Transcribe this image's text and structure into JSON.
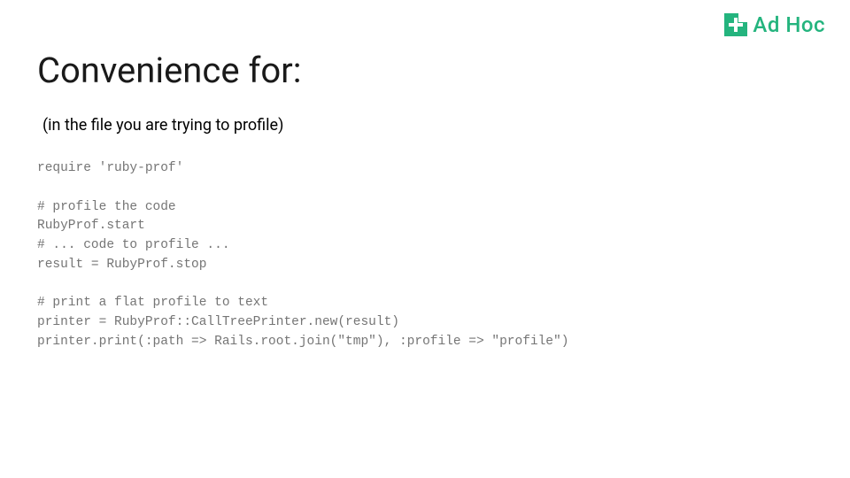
{
  "logo": {
    "brand_text": "Ad Hoc"
  },
  "slide": {
    "title": "Convenience for:",
    "subtitle": "(in the file you are trying to profile)",
    "code": "require 'ruby-prof'\n\n# profile the code\nRubyProf.start\n# ... code to profile ...\nresult = RubyProf.stop\n\n# print a flat profile to text\nprinter = RubyProf::CallTreePrinter.new(result)\nprinter.print(:path => Rails.root.join(\"tmp\"), :profile => \"profile\")"
  }
}
